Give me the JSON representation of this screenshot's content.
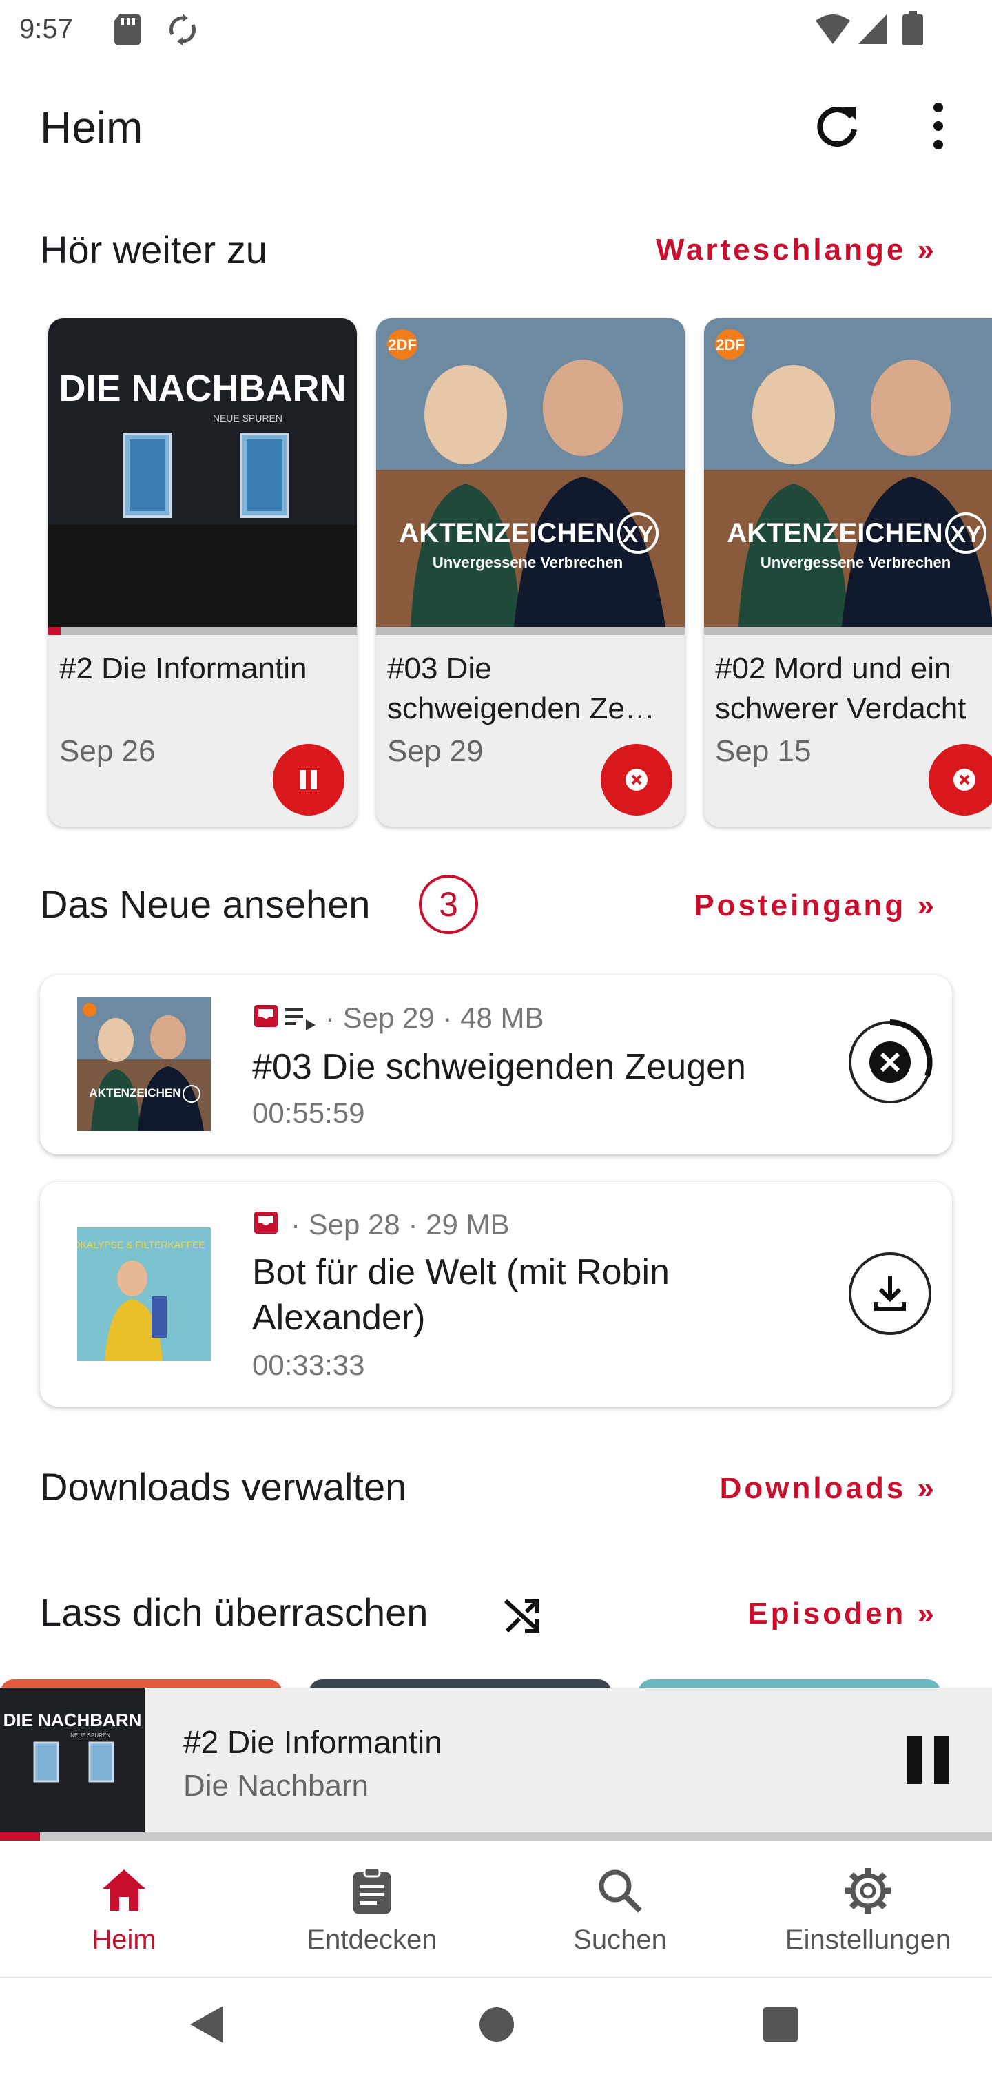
{
  "status_bar": {
    "time": "9:57"
  },
  "app_bar": {
    "title": "Heim",
    "refresh_icon": "refresh-icon",
    "more_icon": "more-vert-icon"
  },
  "continue_section": {
    "title": "Hör weiter zu",
    "link": "Warteschlange »",
    "cards": [
      {
        "title": "#2 Die Informantin",
        "date": "Sep 26",
        "progress": 0.04,
        "action": "pause",
        "cover_title": "DIE NACHBARN",
        "cover_subtitle": "NEUE SPUREN"
      },
      {
        "title": "#03 Die schweigenden Ze…",
        "date": "Sep 29",
        "progress": 0,
        "action": "cancel-download",
        "cover_brand": "2DF",
        "cover_title": "AKTENZEICHEN",
        "cover_subtitle": "Unvergessene Verbrechen"
      },
      {
        "title": "#02 Mord und ein schwerer Verdacht",
        "date": "Sep 15",
        "progress": 0,
        "action": "cancel-download",
        "cover_brand": "2DF",
        "cover_title": "AKTENZEICHEN",
        "cover_subtitle": "Unvergessene Verbrechen"
      }
    ]
  },
  "inbox_section": {
    "title": "Das Neue ansehen",
    "count": "3",
    "link": "Posteingang »",
    "episodes": [
      {
        "meta": "· Sep 29 · 48 MB",
        "title": "#03 Die schweigenden Zeugen",
        "duration": "00:55:59",
        "action": "cancel-download",
        "download_progress": 0.35
      },
      {
        "meta": "· Sep 28 · 29 MB",
        "title": "Bot für die Welt (mit Robin Alexander)",
        "duration": "00:33:33",
        "action": "download",
        "cover_text": "APOKALYPSE & FILTERKAFFEE"
      }
    ]
  },
  "downloads_section": {
    "title": "Downloads verwalten",
    "link": "Downloads »"
  },
  "surprise_section": {
    "title": "Lass dich überraschen",
    "link": "Episoden »",
    "icon": "shuffle-icon"
  },
  "mini_player": {
    "title": "#2 Die Informantin",
    "podcast": "Die Nachbarn",
    "progress": 0.04,
    "cover_title": "DIE NACHBARN",
    "cover_subtitle": "NEUE SPUREN"
  },
  "bottom_nav": {
    "items": [
      {
        "label": "Heim",
        "icon": "home-icon",
        "active": true
      },
      {
        "label": "Entdecken",
        "icon": "clipboard-icon",
        "active": false
      },
      {
        "label": "Suchen",
        "icon": "search-icon",
        "active": false
      },
      {
        "label": "Einstellungen",
        "icon": "gear-icon",
        "active": false
      }
    ]
  },
  "colors": {
    "accent": "#c8102e",
    "background": "#ffffff",
    "card": "#eeeeee"
  }
}
